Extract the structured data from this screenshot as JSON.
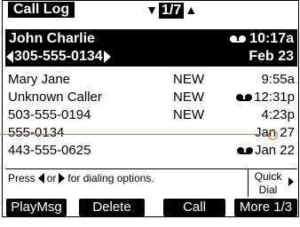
{
  "header": {
    "title": "Call Log",
    "pager": "1/7"
  },
  "selected": {
    "name": "John Charlie",
    "time": "10:17a",
    "number": "305-555-0134",
    "date": "Feb 23"
  },
  "rows": [
    {
      "name": "Mary Jane",
      "status": "NEW",
      "when": "9:55a",
      "icon": ""
    },
    {
      "name": "Unknown Caller",
      "status": "NEW",
      "when": "12:31p",
      "icon": "voicemail-icon"
    },
    {
      "name": "503-555-0194",
      "status": "NEW",
      "when": "4:23p",
      "icon": ""
    },
    {
      "name": "555-0134",
      "status": "",
      "when": "Jan 27",
      "icon": ""
    },
    {
      "name": "443-555-0625",
      "status": "",
      "when": "Jan 22",
      "icon": "voicemail-icon"
    }
  ],
  "hint": {
    "press": "Press",
    "or": "or",
    "rest": "for dialing options."
  },
  "quick": {
    "line1": "Quick",
    "line2": "Dial"
  },
  "softkeys": [
    "PlayMsg",
    "Delete",
    "Call",
    "More 1/3"
  ],
  "colors": {
    "callout": "#d4761d"
  }
}
